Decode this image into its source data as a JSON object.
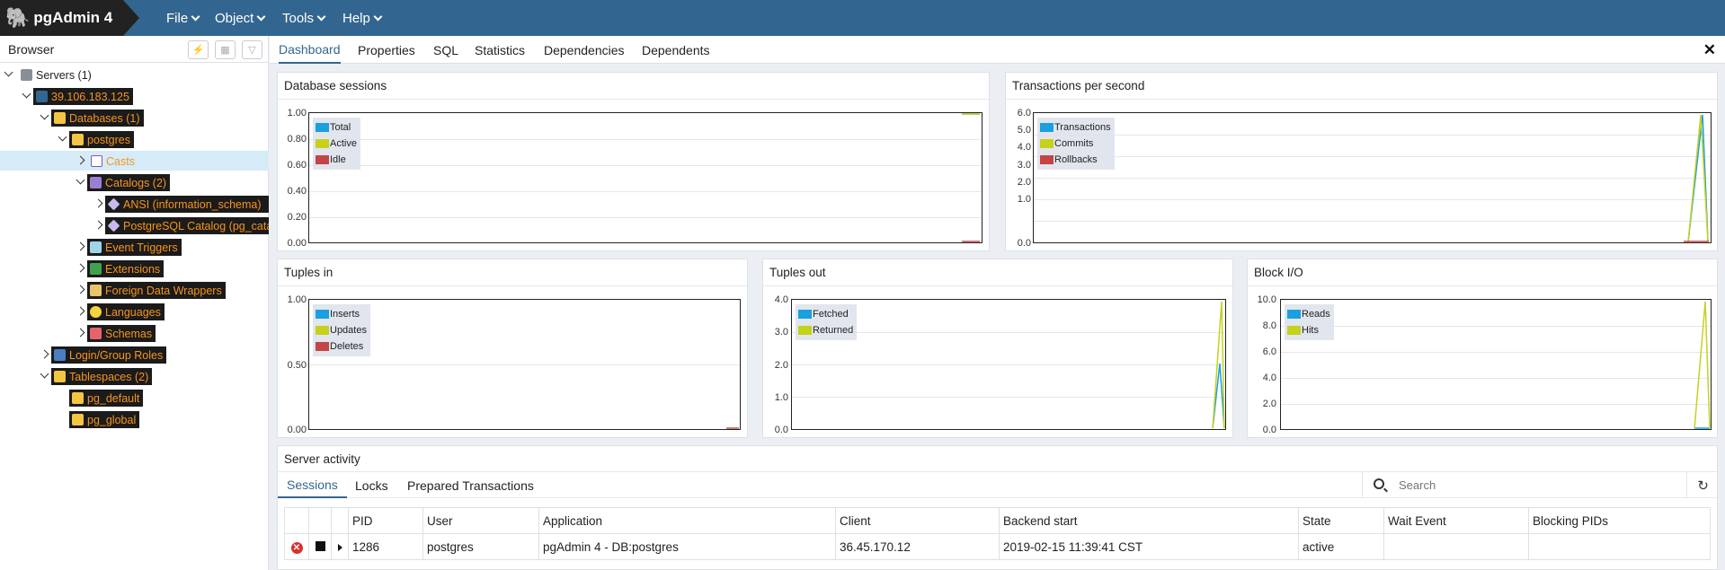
{
  "app": {
    "brand": "pgAdmin 4"
  },
  "menu": {
    "file": "File",
    "object": "Object",
    "tools": "Tools",
    "help": "Help"
  },
  "browser": {
    "title": "Browser",
    "tree": [
      {
        "label": "Servers (1)"
      },
      {
        "label": "39.106.183.125"
      },
      {
        "label": "Databases (1)"
      },
      {
        "label": "postgres"
      },
      {
        "label": "Casts"
      },
      {
        "label": "Catalogs (2)"
      },
      {
        "label": "ANSI (information_schema)"
      },
      {
        "label": "PostgreSQL Catalog (pg_catalog)"
      },
      {
        "label": "Event Triggers"
      },
      {
        "label": "Extensions"
      },
      {
        "label": "Foreign Data Wrappers"
      },
      {
        "label": "Languages"
      },
      {
        "label": "Schemas"
      },
      {
        "label": "Login/Group Roles"
      },
      {
        "label": "Tablespaces (2)"
      },
      {
        "label": "pg_default"
      },
      {
        "label": "pg_global"
      }
    ]
  },
  "tabs": [
    "Dashboard",
    "Properties",
    "SQL",
    "Statistics",
    "Dependencies",
    "Dependents"
  ],
  "colors": {
    "blue": "#1a9fe0",
    "yellow": "#c5d21b",
    "red": "#c44545",
    "accent": "#326690"
  },
  "charts": {
    "sessions": {
      "title": "Database sessions",
      "yticks": [
        "1.00",
        "0.80",
        "0.60",
        "0.40",
        "0.20",
        "0.00"
      ],
      "legend": [
        "Total",
        "Active",
        "Idle"
      ]
    },
    "tps": {
      "title": "Transactions per second",
      "yticks": [
        "6.0",
        "5.0",
        "4.0",
        "3.0",
        "2.0",
        "1.0",
        "0.0"
      ],
      "legend": [
        "Transactions",
        "Commits",
        "Rollbacks"
      ]
    },
    "tuples_in": {
      "title": "Tuples in",
      "yticks": [
        "1.00",
        "0.50",
        "0.00"
      ],
      "legend": [
        "Inserts",
        "Updates",
        "Deletes"
      ]
    },
    "tuples_out": {
      "title": "Tuples out",
      "yticks": [
        "4.0",
        "3.0",
        "2.0",
        "1.0",
        "0.0"
      ],
      "legend": [
        "Fetched",
        "Returned"
      ]
    },
    "block_io": {
      "title": "Block I/O",
      "yticks": [
        "10.0",
        "8.0",
        "6.0",
        "4.0",
        "2.0",
        "0.0"
      ],
      "legend": [
        "Reads",
        "Hits"
      ]
    }
  },
  "chart_data": [
    {
      "type": "line",
      "title": "Database sessions",
      "ylim": [
        0,
        1
      ],
      "series": [
        {
          "name": "Total",
          "values": [
            0,
            1
          ]
        },
        {
          "name": "Active",
          "values": [
            0,
            1
          ]
        },
        {
          "name": "Idle",
          "values": [
            0,
            0
          ]
        }
      ]
    },
    {
      "type": "line",
      "title": "Transactions per second",
      "ylim": [
        0,
        6
      ],
      "series": [
        {
          "name": "Transactions",
          "values": [
            0,
            6,
            0
          ]
        },
        {
          "name": "Commits",
          "values": [
            0,
            6,
            0
          ]
        },
        {
          "name": "Rollbacks",
          "values": [
            0,
            0,
            0
          ]
        }
      ]
    },
    {
      "type": "line",
      "title": "Tuples in",
      "ylim": [
        0,
        1
      ],
      "series": [
        {
          "name": "Inserts",
          "values": [
            0,
            0
          ]
        },
        {
          "name": "Updates",
          "values": [
            0,
            0
          ]
        },
        {
          "name": "Deletes",
          "values": [
            0,
            0
          ]
        }
      ]
    },
    {
      "type": "line",
      "title": "Tuples out",
      "ylim": [
        0,
        4
      ],
      "series": [
        {
          "name": "Fetched",
          "values": [
            0,
            2,
            0
          ]
        },
        {
          "name": "Returned",
          "values": [
            0,
            4,
            0
          ]
        }
      ]
    },
    {
      "type": "line",
      "title": "Block I/O",
      "ylim": [
        0,
        10
      ],
      "series": [
        {
          "name": "Reads",
          "values": [
            0,
            0,
            0
          ]
        },
        {
          "name": "Hits",
          "values": [
            0,
            10,
            0
          ]
        }
      ]
    }
  ],
  "activity": {
    "title": "Server activity",
    "tabs": [
      "Sessions",
      "Locks",
      "Prepared Transactions"
    ],
    "search_placeholder": "Search",
    "columns": [
      "PID",
      "User",
      "Application",
      "Client",
      "Backend start",
      "State",
      "Wait Event",
      "Blocking PIDs"
    ],
    "rows": [
      {
        "pid": "1286",
        "user": "postgres",
        "application": "pgAdmin 4 - DB:postgres",
        "client": "36.45.170.12",
        "backend_start": "2019-02-15 11:39:41 CST",
        "state": "active",
        "wait_event": "",
        "blocking_pids": ""
      }
    ]
  }
}
